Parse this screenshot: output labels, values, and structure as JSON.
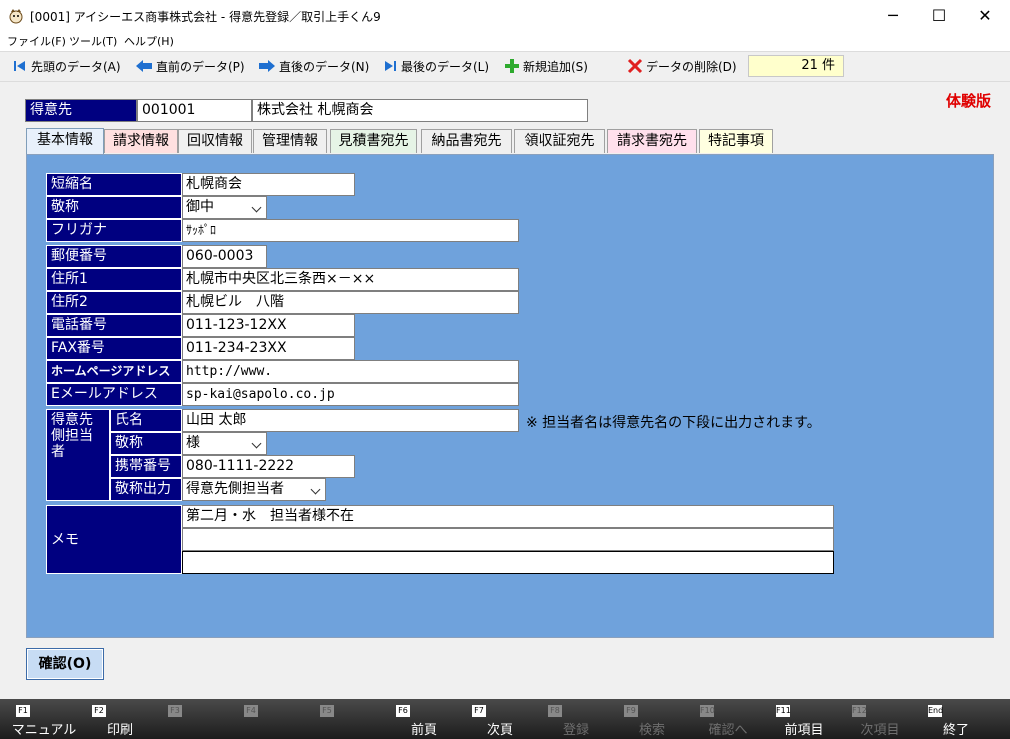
{
  "window": {
    "title": "[0001] アイシーエス商事株式会社 - 得意先登録／取引上手くん9",
    "minimize": "─",
    "maximize": "☐",
    "close": "✕"
  },
  "menu": [
    "ファイル(F)",
    "ツール(T)",
    "ヘルプ(H)"
  ],
  "toolbar": {
    "first": "先頭のデータ(A)",
    "prev": "直前のデータ(P)",
    "next": "直後のデータ(N)",
    "last": "最後のデータ(L)",
    "add": "新規追加(S)",
    "delete": "データの削除(D)",
    "count": "21 件"
  },
  "trial_label": "体験版",
  "customer": {
    "label": "得意先",
    "code": "001001",
    "name": "株式会社 札幌商会"
  },
  "tabs": [
    {
      "label": "基本情報",
      "color": "#e8f0fb"
    },
    {
      "label": "請求情報",
      "color": "#ffe0e0"
    },
    {
      "label": "回収情報",
      "color": "#f0f0f0"
    },
    {
      "label": "管理情報",
      "color": "#f0f0f0"
    },
    {
      "label": "見積書宛先",
      "color": "#e6f4e6"
    },
    {
      "label": "納品書宛先",
      "color": "#f0f0f0"
    },
    {
      "label": "領収証宛先",
      "color": "#f0f0f0"
    },
    {
      "label": "請求書宛先",
      "color": "#ffe0ec"
    },
    {
      "label": "特記事項",
      "color": "#ffffe0"
    }
  ],
  "form": {
    "short_name": {
      "label": "短縮名",
      "value": "札幌商会"
    },
    "honorific": {
      "label": "敬称",
      "value": "御中"
    },
    "furigana": {
      "label": "フリガナ",
      "value": "ｻｯﾎﾟﾛ"
    },
    "zip": {
      "label": "郵便番号",
      "value": "060-0003"
    },
    "address1": {
      "label": "住所1",
      "value": "札幌市中央区北三条西×－××"
    },
    "address2": {
      "label": "住所2",
      "value": "札幌ビル　八階"
    },
    "phone": {
      "label": "電話番号",
      "value": "011-123-12XX"
    },
    "fax": {
      "label": "FAX番号",
      "value": "011-234-23XX"
    },
    "homepage": {
      "label": "ホームページアドレス",
      "value": "http://www."
    },
    "email": {
      "label": "Eメールアドレス",
      "value": "sp-kai@sapolo.co.jp"
    },
    "contact_group_label": "得意先側担当者",
    "contact_name": {
      "label": "氏名",
      "value": "山田 太郎"
    },
    "contact_note": "※ 担当者名は得意先名の下段に出力されます。",
    "contact_honorific": {
      "label": "敬称",
      "value": "様"
    },
    "mobile": {
      "label": "携帯番号",
      "value": "080-1111-2222"
    },
    "honorific_output": {
      "label": "敬称出力",
      "value": "得意先側担当者"
    },
    "memo": {
      "label": "メモ",
      "lines": [
        "第二月・水　担当者様不在",
        "",
        ""
      ]
    }
  },
  "confirm_button": "確認(O)",
  "function_keys": [
    {
      "key": "F1",
      "label": "マニュアル",
      "enabled": true
    },
    {
      "key": "F2",
      "label": "印刷",
      "enabled": true
    },
    {
      "key": "F3",
      "label": "",
      "enabled": false
    },
    {
      "key": "F4",
      "label": "",
      "enabled": false
    },
    {
      "key": "F5",
      "label": "",
      "enabled": false
    },
    {
      "key": "F6",
      "label": "前頁",
      "enabled": true
    },
    {
      "key": "F7",
      "label": "次頁",
      "enabled": true
    },
    {
      "key": "F8",
      "label": "登録",
      "enabled": false
    },
    {
      "key": "F9",
      "label": "検索",
      "enabled": false
    },
    {
      "key": "F10",
      "label": "確認へ",
      "enabled": false
    },
    {
      "key": "F11",
      "label": "前項目",
      "enabled": true
    },
    {
      "key": "F12",
      "label": "次項目",
      "enabled": false
    },
    {
      "key": "End",
      "label": "終了",
      "enabled": true
    }
  ]
}
